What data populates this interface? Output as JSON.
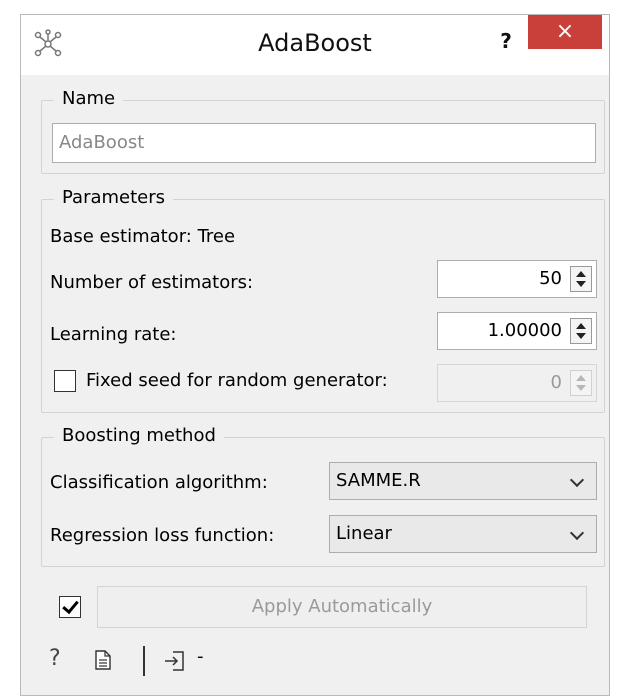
{
  "window": {
    "title": "AdaBoost",
    "help_label": "?",
    "close_label": "×"
  },
  "name_group": {
    "title": "Name",
    "value": "AdaBoost"
  },
  "parameters": {
    "title": "Parameters",
    "base_estimator": "Base estimator: Tree",
    "n_estimators_label": "Number of estimators:",
    "n_estimators_value": "50",
    "learning_rate_label": "Learning rate:",
    "learning_rate_value": "1.00000",
    "fixed_seed_label": "Fixed seed for random generator:",
    "fixed_seed_checked": false,
    "seed_value": "0"
  },
  "boosting": {
    "title": "Boosting method",
    "classification_label": "Classification algorithm:",
    "classification_value": "SAMME.R",
    "regression_label": "Regression loss function:",
    "regression_value": "Linear"
  },
  "apply": {
    "checked": true,
    "label": "Apply Automatically"
  },
  "status_bar": {
    "help_icon": "?",
    "dash": "-"
  },
  "colors": {
    "close": "#c9403a",
    "window_bg": "#f0f0f0"
  }
}
